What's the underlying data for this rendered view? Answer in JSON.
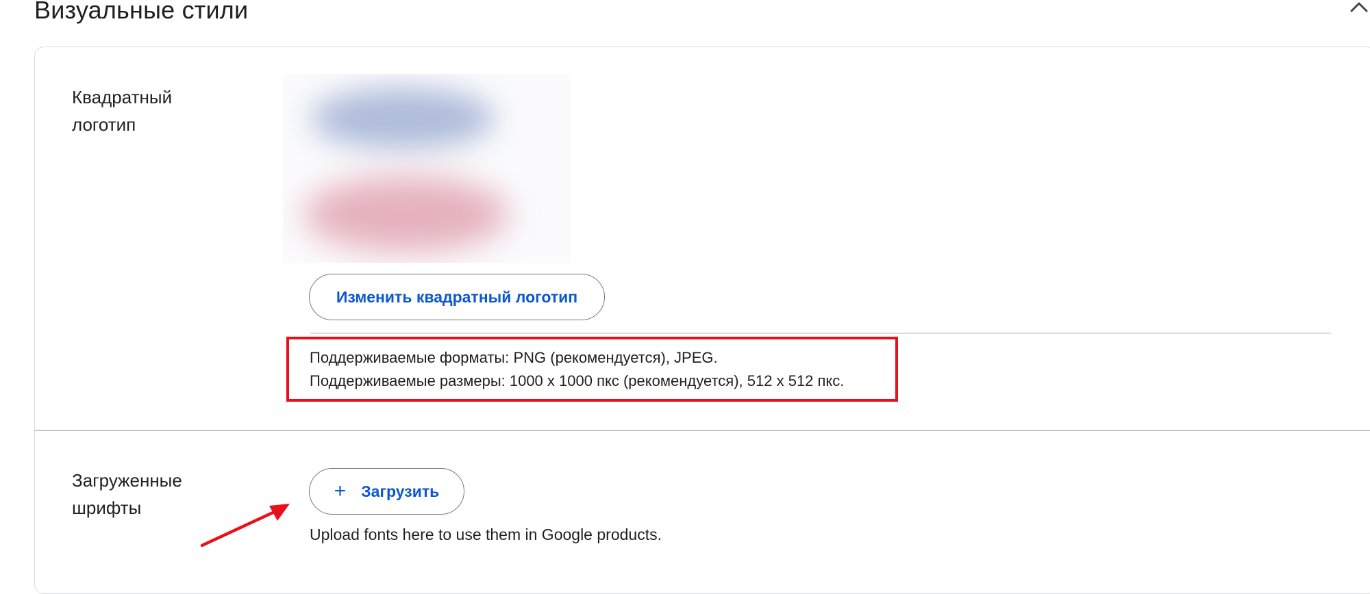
{
  "section": {
    "title": "Визуальные стили",
    "toggle_icon": "chevron-up-icon"
  },
  "square_logo": {
    "label": "Квадратный логотип",
    "preview_icon": "logo-image",
    "change_button_label": "Изменить квадратный логотип",
    "formats_line": "Поддерживаемые форматы: PNG (рекомендуется), JPEG.",
    "sizes_line": "Поддерживаемые размеры: 1000 x 1000 пкс (рекомендуется), 512 x 512 пкс."
  },
  "fonts": {
    "label": "Загруженные шрифты",
    "upload_icon": "plus-icon",
    "upload_button_label": "Загрузить",
    "helper_text": "Upload fonts here to use them in Google products."
  },
  "colors": {
    "accent": "#0b57d0",
    "annotation": "#e8101a"
  }
}
